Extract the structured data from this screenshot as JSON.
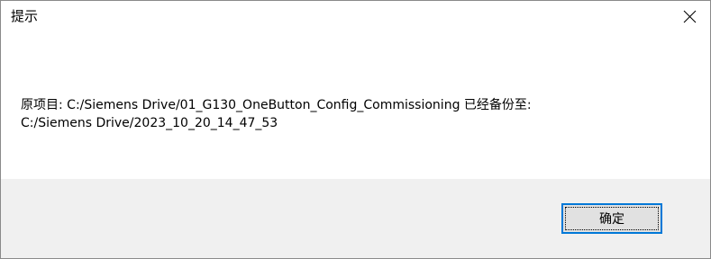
{
  "dialog": {
    "title": "提示",
    "close_icon": "close-icon",
    "message_line_1": "原项目: C:/Siemens Drive/01_G130_OneButton_Config_Commissioning 已经备份至:",
    "message_line_2": "C:/Siemens Drive/2023_10_20_14_47_53",
    "ok_label": "确定",
    "accent_color": "#0078d7",
    "footer_color": "#f0f0f0"
  }
}
